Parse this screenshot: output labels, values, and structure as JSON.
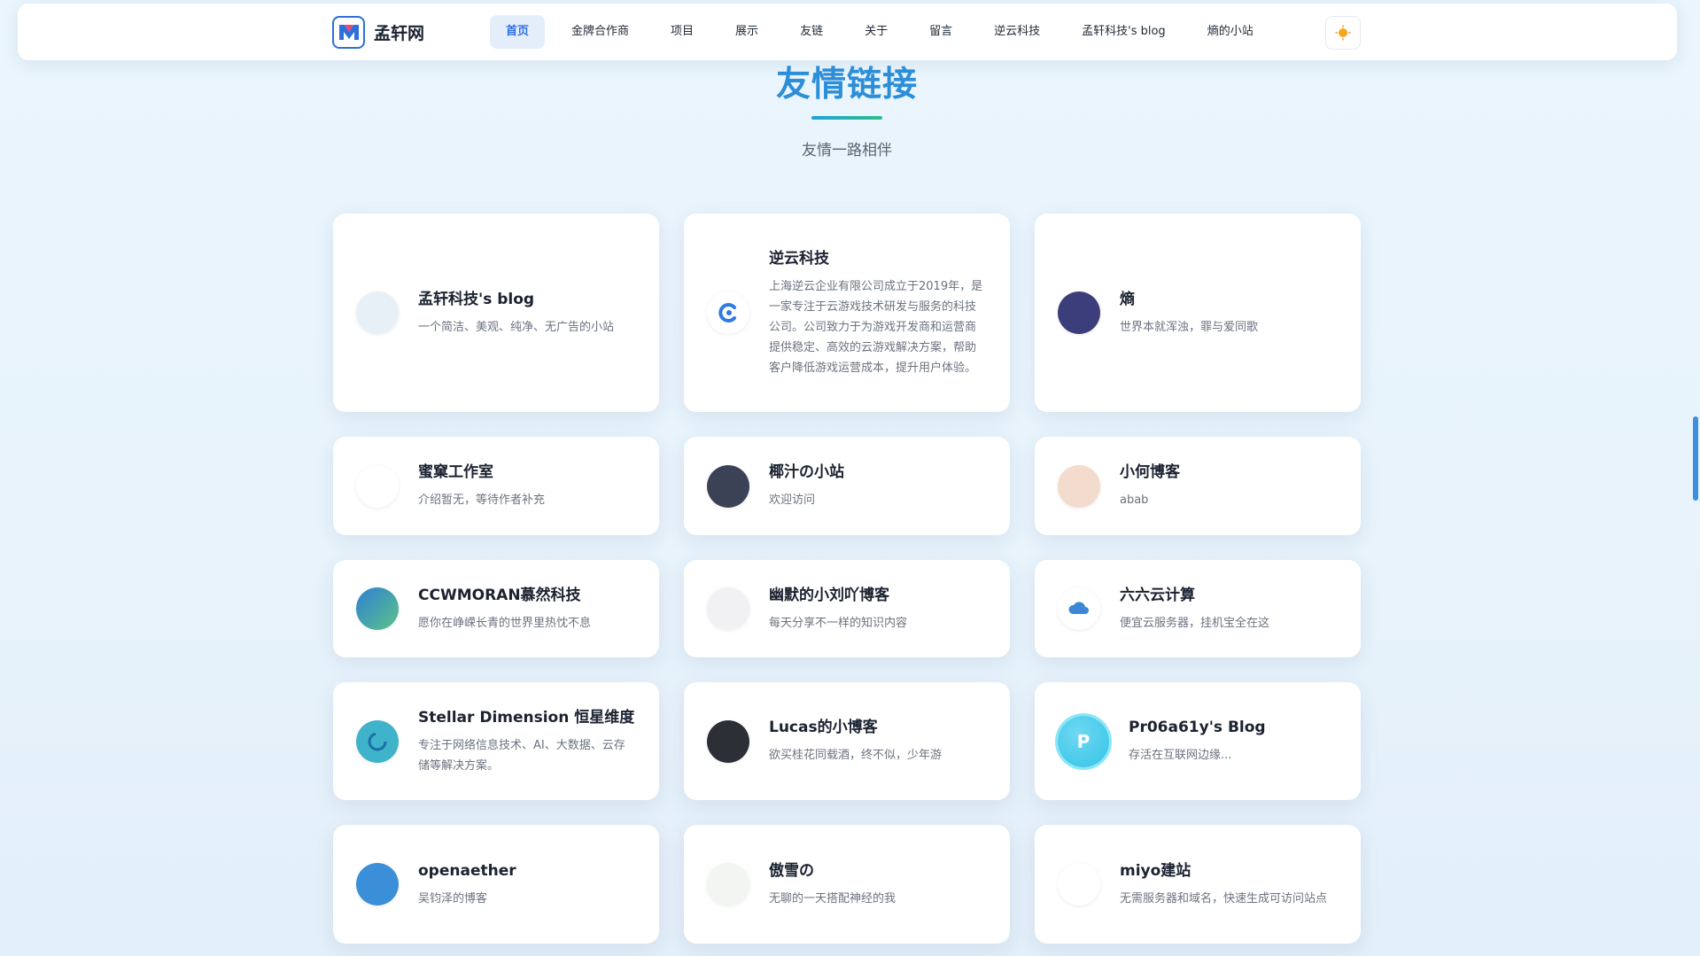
{
  "brand": {
    "name": "孟轩网",
    "logo_icon": "m-logo-icon"
  },
  "nav": [
    {
      "label": "首页",
      "active": true
    },
    {
      "label": "金牌合作商"
    },
    {
      "label": "项目"
    },
    {
      "label": "展示"
    },
    {
      "label": "友链"
    },
    {
      "label": "关于"
    },
    {
      "label": "留言"
    },
    {
      "label": "逆云科技"
    },
    {
      "label": "孟轩科技's blog"
    },
    {
      "label": "熵的小站"
    }
  ],
  "theme_toggle_icon": "sun-icon",
  "section": {
    "title": "友情链接",
    "subtitle": "友情一路相伴"
  },
  "colors": {
    "accent": "#2d6fe0",
    "title_start": "#22a1d8",
    "title_end": "#2bc08d"
  },
  "links": [
    {
      "name": "孟轩科技's blog",
      "desc": "一个简洁、美观、纯净、无广告的小站",
      "avatar_icon": "anime-avatar-icon",
      "avatar_bg": "#e8f0f7",
      "glyph": ""
    },
    {
      "name": "逆云科技",
      "desc": "上海逆云企业有限公司成立于2019年，是一家专注于云游戏技术研发与服务的科技公司。公司致力于为游戏开发商和运营商提供稳定、高效的云游戏解决方案，帮助客户降低游戏运营成本，提升用户体验。",
      "avatar_icon": "c-logo-icon",
      "avatar_bg": "#ffffff",
      "glyph": ""
    },
    {
      "name": "熵",
      "desc": "世界本就浑浊，罪与爱同歌",
      "avatar_icon": "night-sky-avatar-icon",
      "avatar_bg": "#3b3e7a",
      "glyph": ""
    },
    {
      "name": "蜜窠工作室",
      "desc": "介绍暂无，等待作者补充",
      "avatar_icon": "studio-logo-icon",
      "avatar_bg": "#ffffff",
      "glyph": ""
    },
    {
      "name": "椰汁の小站",
      "desc": "欢迎访问",
      "avatar_icon": "dark-anime-avatar-icon",
      "avatar_bg": "#3c4256",
      "glyph": ""
    },
    {
      "name": "小何博客",
      "desc": "abab",
      "avatar_icon": "girl-avatar-icon",
      "avatar_bg": "#f3dccd",
      "glyph": ""
    },
    {
      "name": "CCWMORAN慕然科技",
      "desc": "愿你在峥嵘长青的世界里热忱不息",
      "avatar_icon": "gradient-logo-icon",
      "avatar_bg": "#4aa8d8",
      "glyph": ""
    },
    {
      "name": "幽默的小刘吖博客",
      "desc": "每天分享不一样的知识内容",
      "avatar_icon": "white-hair-avatar-icon",
      "avatar_bg": "#f1f1f3",
      "glyph": ""
    },
    {
      "name": "六六云计算",
      "desc": "便宜云服务器，挂机宝全在这",
      "avatar_icon": "cloud-logo-icon",
      "avatar_bg": "#ffffff",
      "glyph": ""
    },
    {
      "name": "Stellar Dimension 恒星维度",
      "desc": "专注于网络信息技术、AI、大数据、云存储等解决方案。",
      "avatar_icon": "ring-logo-icon",
      "avatar_bg": "#3fb3c9",
      "glyph": ""
    },
    {
      "name": "Lucas的小博客",
      "desc": "欲买桂花同载酒，终不似，少年游",
      "avatar_icon": "astronaut-avatar-icon",
      "avatar_bg": "#2c2f36",
      "glyph": ""
    },
    {
      "name": "Pr06a61y's Blog",
      "desc": "存活在互联网边缘...",
      "avatar_icon": "letter-p-icon",
      "avatar_bg": "#33c3e6",
      "glyph": "P"
    },
    {
      "name": "openaether",
      "desc": "吴钧泽的博客",
      "avatar_icon": "cartoon-avatar-icon",
      "avatar_bg": "#3a8fd8",
      "glyph": ""
    },
    {
      "name": "傲雪の",
      "desc": "无聊的一天搭配神经的我",
      "avatar_icon": "sketch-avatar-icon",
      "avatar_bg": "#f3f5f2",
      "glyph": ""
    },
    {
      "name": "miyo建站",
      "desc": "无需服务器和域名，快速生成可访问站点",
      "avatar_icon": "miyo-logo-icon",
      "avatar_bg": "#ffffff",
      "glyph": ""
    }
  ]
}
